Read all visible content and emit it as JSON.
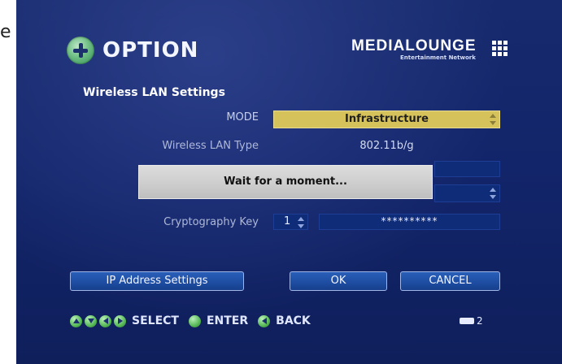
{
  "stray": {
    "text": "e"
  },
  "header": {
    "title": "OPTION"
  },
  "brand": {
    "name": "MEDIALOUNGE",
    "tagline": "Entertainment Network"
  },
  "section": {
    "title": "Wireless LAN Settings"
  },
  "fields": {
    "mode": {
      "label": "MODE",
      "value": "Infrastructure"
    },
    "wireless_lan_type": {
      "label": "Wireless LAN Type",
      "value": "802.11b/g"
    },
    "cryptography_key": {
      "label": "Cryptography Key",
      "index": "1",
      "value": "**********"
    }
  },
  "dialog": {
    "message": "Wait for a moment..."
  },
  "buttons": {
    "ip_address_settings": "IP Address Settings",
    "ok": "OK",
    "cancel": "CANCEL"
  },
  "hints": {
    "select": "SELECT",
    "enter": "ENTER",
    "back": "BACK"
  },
  "page_indicator": {
    "number": "2"
  },
  "colors": {
    "background": "#13256a",
    "highlight": "#d6c25b",
    "dialog": "#cfcfcf",
    "button": "#1e4ea3"
  }
}
